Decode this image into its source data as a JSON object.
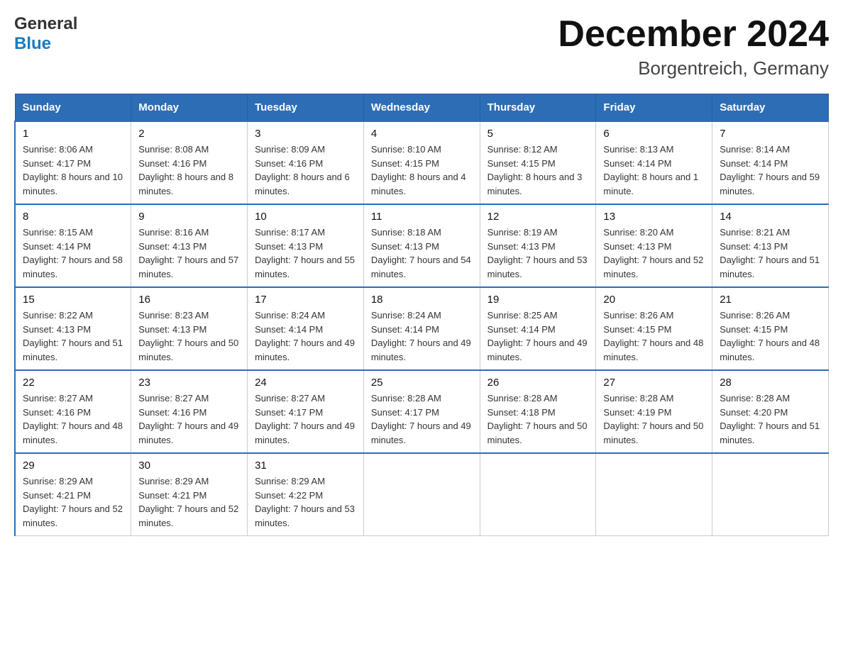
{
  "header": {
    "logo_general": "General",
    "logo_blue": "Blue",
    "month_title": "December 2024",
    "location": "Borgentreich, Germany"
  },
  "days_of_week": [
    "Sunday",
    "Monday",
    "Tuesday",
    "Wednesday",
    "Thursday",
    "Friday",
    "Saturday"
  ],
  "weeks": [
    [
      {
        "day": "1",
        "sunrise": "8:06 AM",
        "sunset": "4:17 PM",
        "daylight": "8 hours and 10 minutes."
      },
      {
        "day": "2",
        "sunrise": "8:08 AM",
        "sunset": "4:16 PM",
        "daylight": "8 hours and 8 minutes."
      },
      {
        "day": "3",
        "sunrise": "8:09 AM",
        "sunset": "4:16 PM",
        "daylight": "8 hours and 6 minutes."
      },
      {
        "day": "4",
        "sunrise": "8:10 AM",
        "sunset": "4:15 PM",
        "daylight": "8 hours and 4 minutes."
      },
      {
        "day": "5",
        "sunrise": "8:12 AM",
        "sunset": "4:15 PM",
        "daylight": "8 hours and 3 minutes."
      },
      {
        "day": "6",
        "sunrise": "8:13 AM",
        "sunset": "4:14 PM",
        "daylight": "8 hours and 1 minute."
      },
      {
        "day": "7",
        "sunrise": "8:14 AM",
        "sunset": "4:14 PM",
        "daylight": "7 hours and 59 minutes."
      }
    ],
    [
      {
        "day": "8",
        "sunrise": "8:15 AM",
        "sunset": "4:14 PM",
        "daylight": "7 hours and 58 minutes."
      },
      {
        "day": "9",
        "sunrise": "8:16 AM",
        "sunset": "4:13 PM",
        "daylight": "7 hours and 57 minutes."
      },
      {
        "day": "10",
        "sunrise": "8:17 AM",
        "sunset": "4:13 PM",
        "daylight": "7 hours and 55 minutes."
      },
      {
        "day": "11",
        "sunrise": "8:18 AM",
        "sunset": "4:13 PM",
        "daylight": "7 hours and 54 minutes."
      },
      {
        "day": "12",
        "sunrise": "8:19 AM",
        "sunset": "4:13 PM",
        "daylight": "7 hours and 53 minutes."
      },
      {
        "day": "13",
        "sunrise": "8:20 AM",
        "sunset": "4:13 PM",
        "daylight": "7 hours and 52 minutes."
      },
      {
        "day": "14",
        "sunrise": "8:21 AM",
        "sunset": "4:13 PM",
        "daylight": "7 hours and 51 minutes."
      }
    ],
    [
      {
        "day": "15",
        "sunrise": "8:22 AM",
        "sunset": "4:13 PM",
        "daylight": "7 hours and 51 minutes."
      },
      {
        "day": "16",
        "sunrise": "8:23 AM",
        "sunset": "4:13 PM",
        "daylight": "7 hours and 50 minutes."
      },
      {
        "day": "17",
        "sunrise": "8:24 AM",
        "sunset": "4:14 PM",
        "daylight": "7 hours and 49 minutes."
      },
      {
        "day": "18",
        "sunrise": "8:24 AM",
        "sunset": "4:14 PM",
        "daylight": "7 hours and 49 minutes."
      },
      {
        "day": "19",
        "sunrise": "8:25 AM",
        "sunset": "4:14 PM",
        "daylight": "7 hours and 49 minutes."
      },
      {
        "day": "20",
        "sunrise": "8:26 AM",
        "sunset": "4:15 PM",
        "daylight": "7 hours and 48 minutes."
      },
      {
        "day": "21",
        "sunrise": "8:26 AM",
        "sunset": "4:15 PM",
        "daylight": "7 hours and 48 minutes."
      }
    ],
    [
      {
        "day": "22",
        "sunrise": "8:27 AM",
        "sunset": "4:16 PM",
        "daylight": "7 hours and 48 minutes."
      },
      {
        "day": "23",
        "sunrise": "8:27 AM",
        "sunset": "4:16 PM",
        "daylight": "7 hours and 49 minutes."
      },
      {
        "day": "24",
        "sunrise": "8:27 AM",
        "sunset": "4:17 PM",
        "daylight": "7 hours and 49 minutes."
      },
      {
        "day": "25",
        "sunrise": "8:28 AM",
        "sunset": "4:17 PM",
        "daylight": "7 hours and 49 minutes."
      },
      {
        "day": "26",
        "sunrise": "8:28 AM",
        "sunset": "4:18 PM",
        "daylight": "7 hours and 50 minutes."
      },
      {
        "day": "27",
        "sunrise": "8:28 AM",
        "sunset": "4:19 PM",
        "daylight": "7 hours and 50 minutes."
      },
      {
        "day": "28",
        "sunrise": "8:28 AM",
        "sunset": "4:20 PM",
        "daylight": "7 hours and 51 minutes."
      }
    ],
    [
      {
        "day": "29",
        "sunrise": "8:29 AM",
        "sunset": "4:21 PM",
        "daylight": "7 hours and 52 minutes."
      },
      {
        "day": "30",
        "sunrise": "8:29 AM",
        "sunset": "4:21 PM",
        "daylight": "7 hours and 52 minutes."
      },
      {
        "day": "31",
        "sunrise": "8:29 AM",
        "sunset": "4:22 PM",
        "daylight": "7 hours and 53 minutes."
      },
      null,
      null,
      null,
      null
    ]
  ],
  "labels": {
    "sunrise": "Sunrise:",
    "sunset": "Sunset:",
    "daylight": "Daylight:"
  }
}
